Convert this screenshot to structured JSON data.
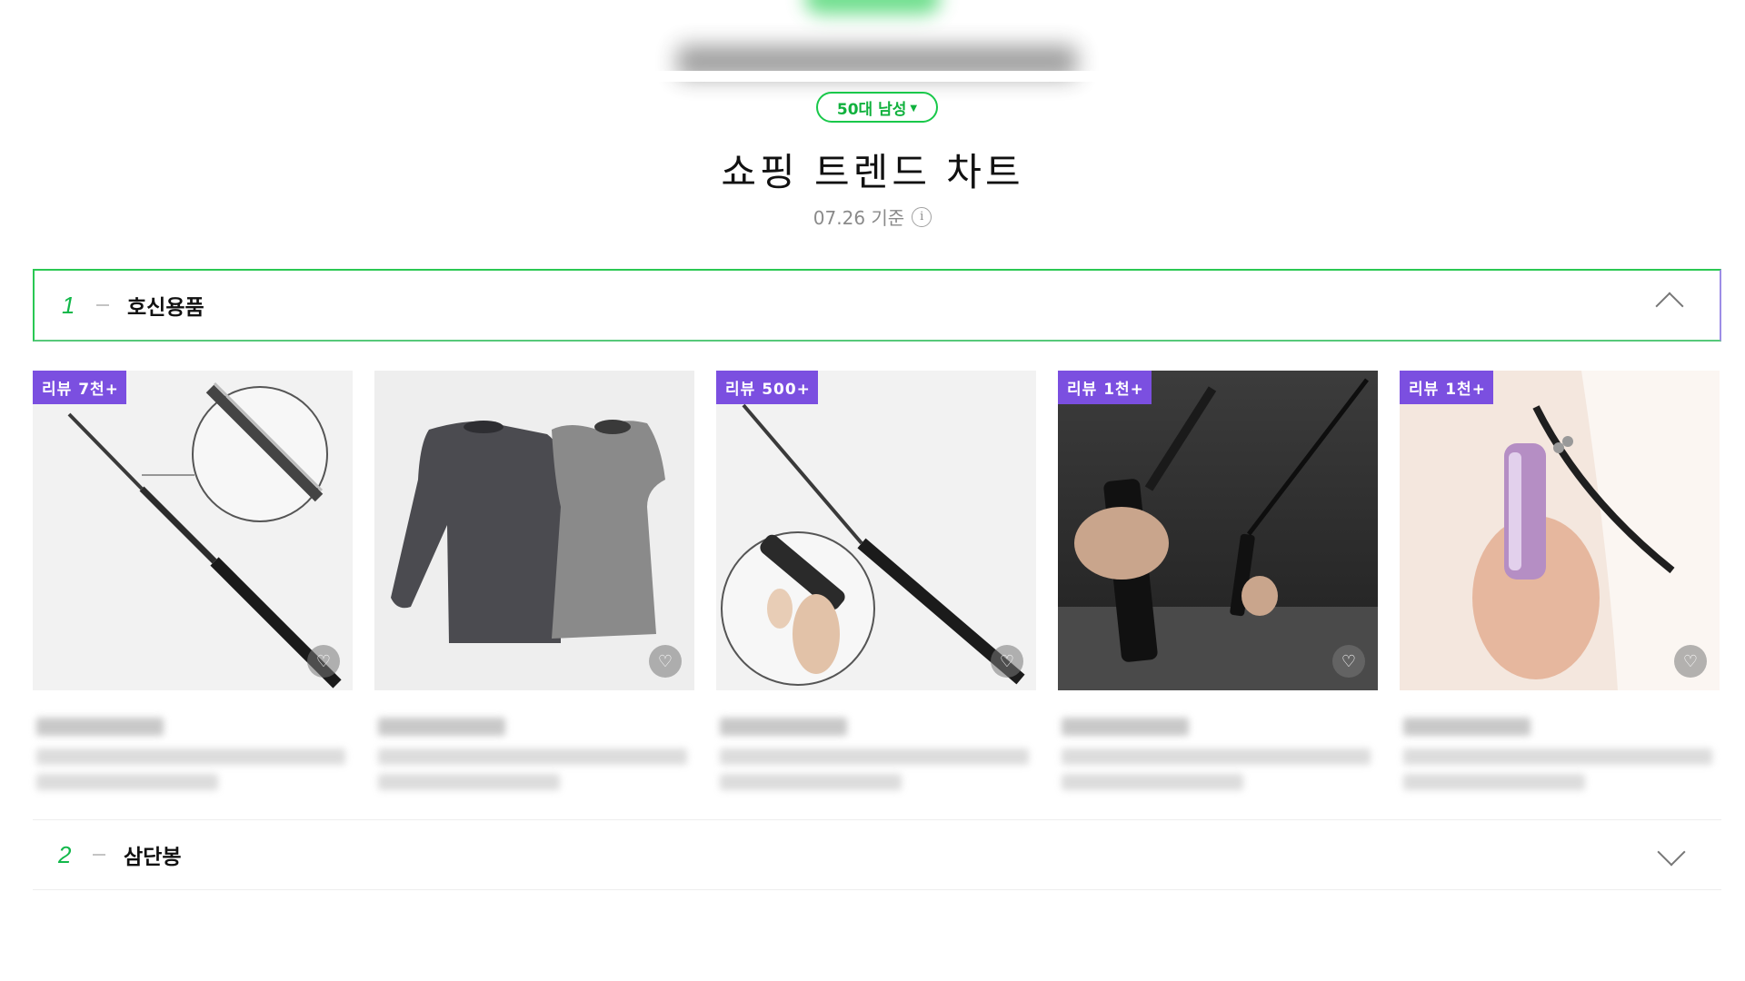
{
  "filter": {
    "label": "50대 남성"
  },
  "title": "쇼핑 트렌드 차트",
  "date": "07.26 기준",
  "ranks": [
    {
      "number": "1",
      "name": "호신용품",
      "products": [
        {
          "badge": "리뷰 7천+",
          "image": "expandable-baton"
        },
        {
          "badge": "",
          "image": "cut-resistant-shirt-and-vest"
        },
        {
          "badge": "리뷰 500+",
          "image": "expandable-baton-with-hand"
        },
        {
          "badge": "리뷰 1천+",
          "image": "baton-in-hand-dark"
        },
        {
          "badge": "리뷰 1천+",
          "image": "purple-spray-keychain"
        }
      ]
    },
    {
      "number": "2",
      "name": "삼단봉"
    }
  ],
  "colors": {
    "accent_green": "#19c84a",
    "badge_purple": "#7b4fe0"
  }
}
